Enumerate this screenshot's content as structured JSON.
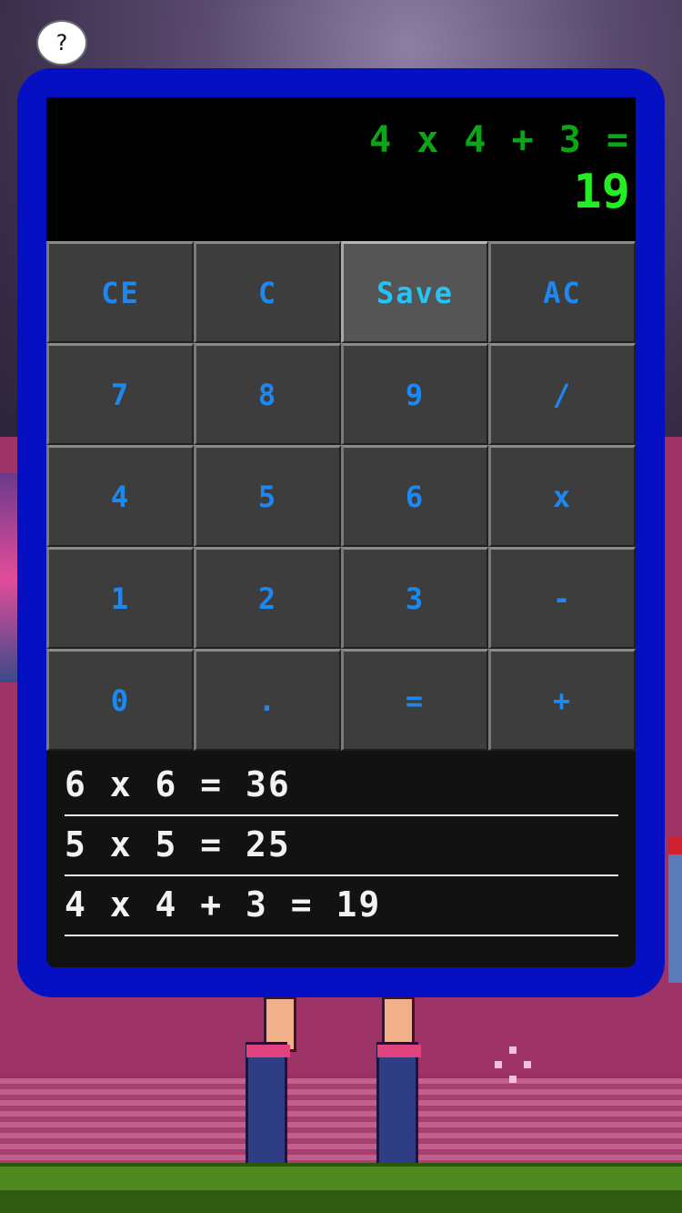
{
  "help": {
    "label": "?"
  },
  "display": {
    "expression": "4 x 4 + 3 =",
    "result": "19",
    "expression_color": "#0ea417",
    "result_color": "#22ee22"
  },
  "keys": [
    {
      "label": "CE",
      "name": "clear-entry-button"
    },
    {
      "label": "C",
      "name": "clear-button"
    },
    {
      "label": "Save",
      "name": "save-button",
      "active": true
    },
    {
      "label": "AC",
      "name": "all-clear-button"
    },
    {
      "label": "7",
      "name": "digit-7-button"
    },
    {
      "label": "8",
      "name": "digit-8-button"
    },
    {
      "label": "9",
      "name": "digit-9-button"
    },
    {
      "label": "/",
      "name": "divide-button"
    },
    {
      "label": "4",
      "name": "digit-4-button"
    },
    {
      "label": "5",
      "name": "digit-5-button"
    },
    {
      "label": "6",
      "name": "digit-6-button"
    },
    {
      "label": "x",
      "name": "multiply-button"
    },
    {
      "label": "1",
      "name": "digit-1-button"
    },
    {
      "label": "2",
      "name": "digit-2-button"
    },
    {
      "label": "3",
      "name": "digit-3-button"
    },
    {
      "label": "-",
      "name": "subtract-button"
    },
    {
      "label": "0",
      "name": "digit-0-button"
    },
    {
      "label": ".",
      "name": "decimal-point-button"
    },
    {
      "label": "=",
      "name": "equals-button"
    },
    {
      "label": "+",
      "name": "add-button"
    }
  ],
  "history": [
    "6 x 6 = 36",
    "5 x 5 = 25",
    "4 x 4 + 3 = 19"
  ],
  "colors": {
    "frame": "#0610c3",
    "key_text": "#1e88f0",
    "key_text_active": "#25c4f5",
    "key_bg": "#3d3d3d"
  }
}
